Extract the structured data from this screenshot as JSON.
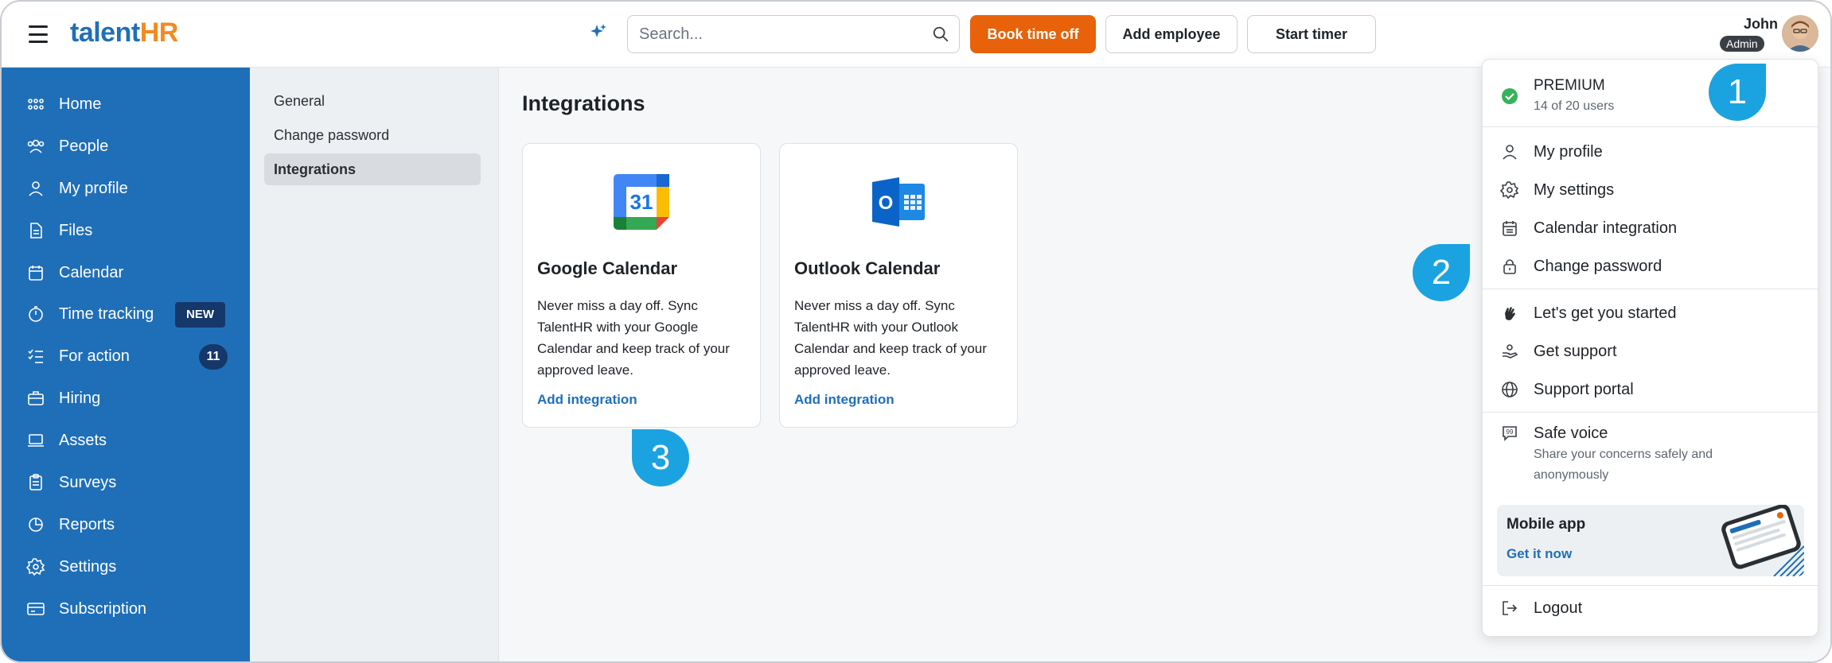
{
  "app": {
    "logo_part1": "talent",
    "logo_part2": "HR"
  },
  "header": {
    "search_placeholder": "Search...",
    "book_time_off": "Book time off",
    "add_employee": "Add employee",
    "start_timer": "Start timer",
    "user_name": "John",
    "user_role": "Admin"
  },
  "sidebar": {
    "items": [
      {
        "label": "Home",
        "icon": "grid-icon"
      },
      {
        "label": "People",
        "icon": "people-icon"
      },
      {
        "label": "My profile",
        "icon": "user-icon"
      },
      {
        "label": "Files",
        "icon": "file-icon"
      },
      {
        "label": "Calendar",
        "icon": "calendar-icon"
      },
      {
        "label": "Time tracking",
        "icon": "stopwatch-icon",
        "badge": "NEW"
      },
      {
        "label": "For action",
        "icon": "checklist-icon",
        "count": "11"
      },
      {
        "label": "Hiring",
        "icon": "briefcase-icon"
      },
      {
        "label": "Assets",
        "icon": "laptop-icon"
      },
      {
        "label": "Surveys",
        "icon": "clipboard-icon"
      },
      {
        "label": "Reports",
        "icon": "pie-chart-icon"
      },
      {
        "label": "Settings",
        "icon": "gear-icon"
      },
      {
        "label": "Subscription",
        "icon": "card-icon"
      }
    ]
  },
  "subnav": {
    "items": [
      "General",
      "Change password",
      "Integrations"
    ],
    "active": "Integrations"
  },
  "main": {
    "title": "Integrations",
    "cards": [
      {
        "title": "Google Calendar",
        "description": "Never miss a day off. Sync TalentHR with your Google Calendar and keep track of your approved leave.",
        "link": "Add integration",
        "icon_text": "31"
      },
      {
        "title": "Outlook Calendar",
        "description": "Never miss a day off. Sync TalentHR with your Outlook Calendar and keep track of your approved leave.",
        "link": "Add integration",
        "icon_text": "O"
      }
    ]
  },
  "dropdown": {
    "premium_title": "PREMIUM",
    "premium_sub": "14 of 20 users",
    "items": [
      {
        "label": "My profile",
        "icon": "user-icon"
      },
      {
        "label": "My settings",
        "icon": "gear-icon"
      },
      {
        "label": "Calendar integration",
        "icon": "calendar-icon"
      },
      {
        "label": "Change password",
        "icon": "lock-icon"
      },
      {
        "label": "Let's get you started",
        "icon": "wave-hand-icon"
      },
      {
        "label": "Get support",
        "icon": "support-hand-icon"
      },
      {
        "label": "Support portal",
        "icon": "globe-icon"
      },
      {
        "label": "Safe voice",
        "icon": "quote-bubble-icon"
      },
      {
        "label": "Logout",
        "icon": "logout-icon"
      }
    ],
    "safe_voice_sub": "Share your concerns safely and anonymously",
    "mobile_title": "Mobile app",
    "mobile_link": "Get it now"
  },
  "callouts": [
    "1",
    "2",
    "3"
  ],
  "colors": {
    "brand_blue": "#1f6fb8",
    "accent_orange": "#e8620a",
    "callout_blue": "#1aa3e0"
  }
}
